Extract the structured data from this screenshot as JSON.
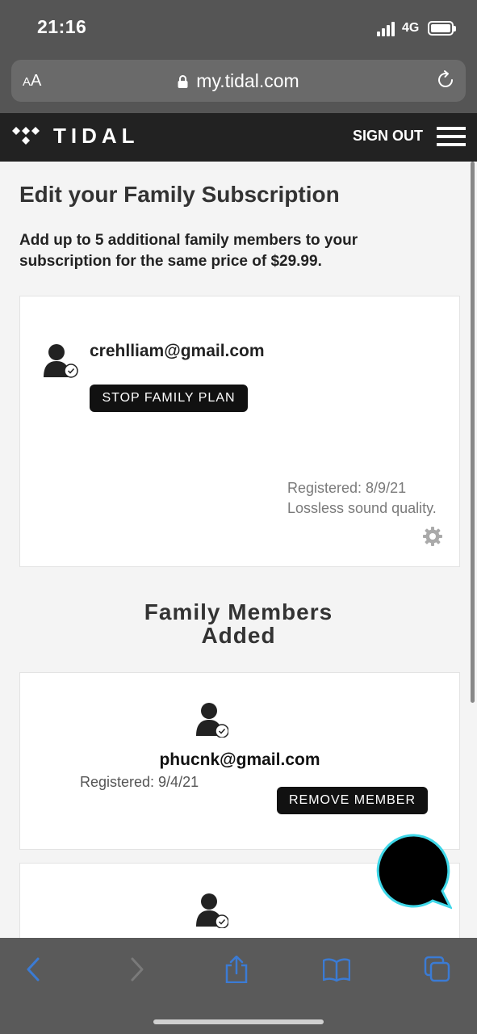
{
  "status_bar": {
    "time": "21:16",
    "network": "4G"
  },
  "browser": {
    "text_size_small": "A",
    "text_size_large": "A",
    "url": "my.tidal.com"
  },
  "header": {
    "brand": "TIDAL",
    "sign_out": "SIGN OUT"
  },
  "main": {
    "title": "Edit your Family Subscription",
    "intro": "Add up to 5 additional family members to your subscription for the same price of $29.99.",
    "owner": {
      "email": "crehlliam@gmail.com",
      "stop_button": "STOP FAMILY PLAN",
      "registered": "Registered: 8/9/21",
      "quality": "Lossless sound quality."
    },
    "members_title_line1": "Family Members",
    "members_title_line2": "Added",
    "members": [
      {
        "email": "phucnk@gmail.com",
        "registered": "Registered: 9/4/21",
        "remove_button": "REMOVE MEMBER"
      }
    ]
  },
  "colors": {
    "header_bg": "#222222",
    "button_bg": "#111111",
    "chat_ring": "#3fd7e8",
    "toolbar_icon": "#3b7bd4"
  }
}
